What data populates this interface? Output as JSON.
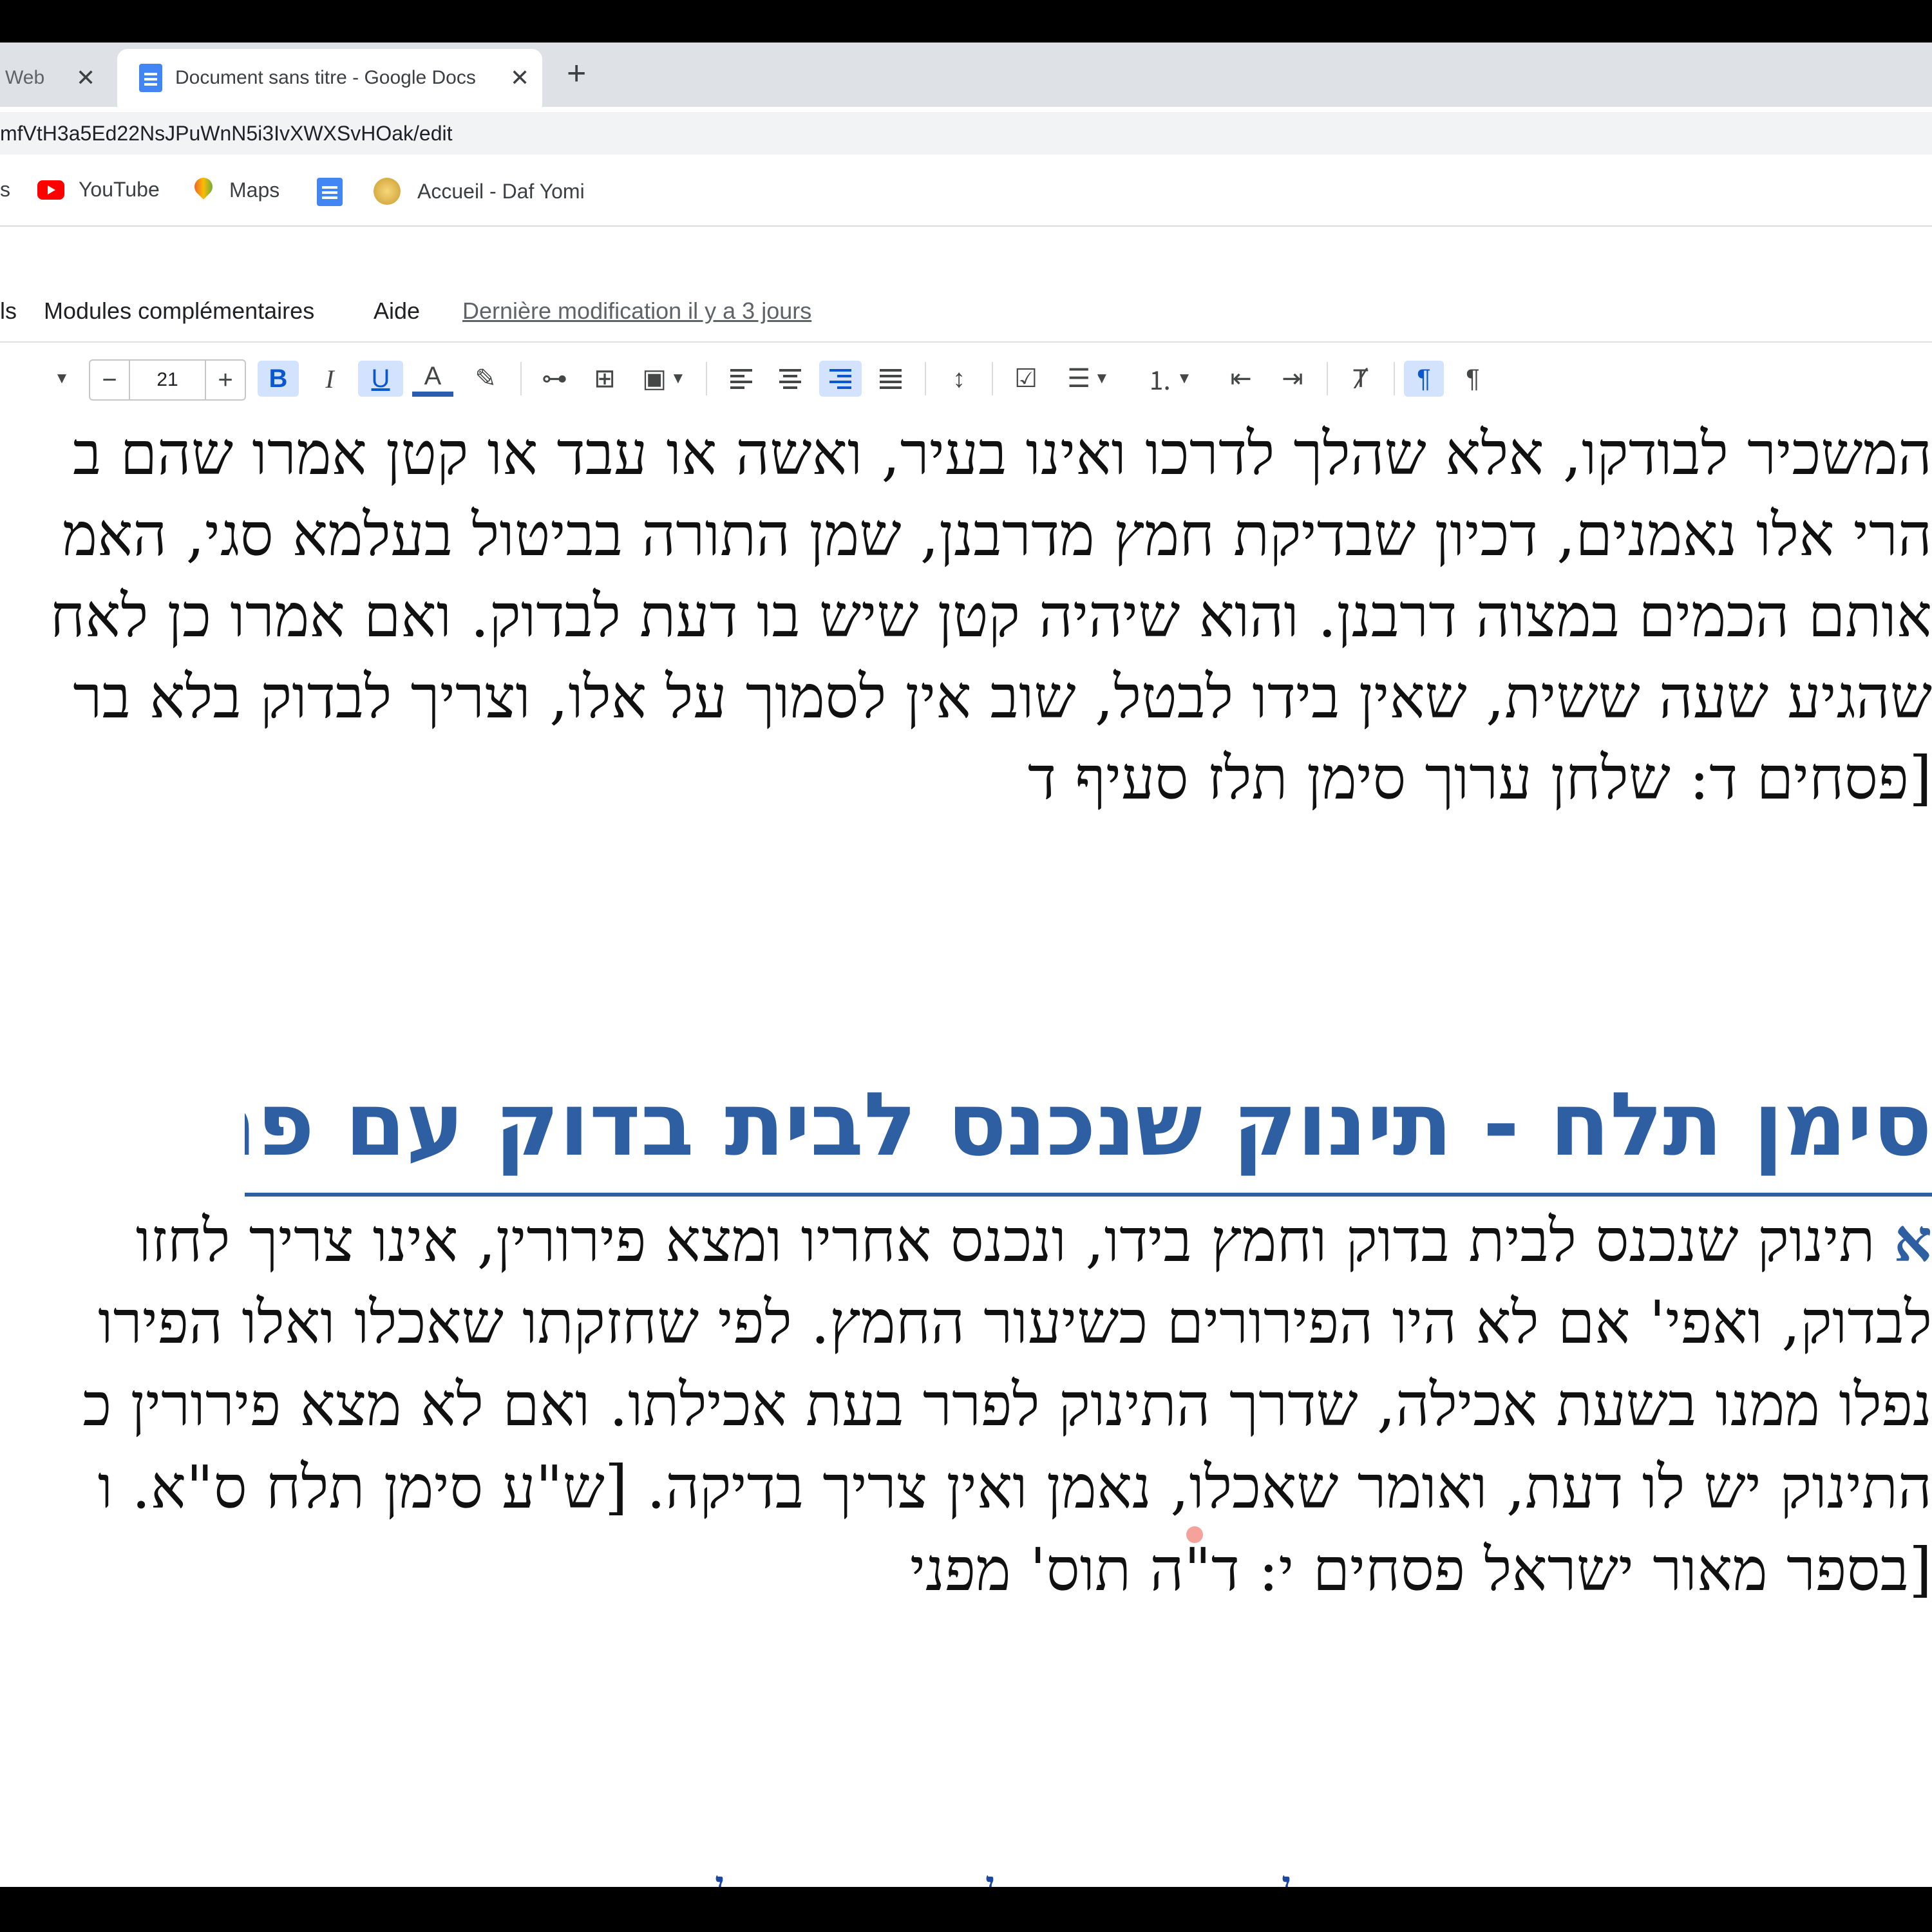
{
  "browser": {
    "tabs": [
      {
        "title": "Web",
        "active": false
      },
      {
        "title": "Document sans titre - Google Docs",
        "active": true
      }
    ],
    "new_tab": "+",
    "close": "✕",
    "url": "mfVtH3a5Ed22NsJPuWnN5i3IvXWXSvHOak/edit",
    "bookmarks": [
      {
        "label": "s",
        "icon": "folder-icon"
      },
      {
        "label": "YouTube",
        "icon": "youtube-icon"
      },
      {
        "label": "Maps",
        "icon": "maps-icon"
      },
      {
        "label": "",
        "icon": "docs-icon"
      },
      {
        "label": "Accueil - Daf Yomi",
        "icon": "daf-yomi-icon"
      }
    ]
  },
  "docs": {
    "menu": [
      "ls",
      "Modules complémentaires",
      "Aide"
    ],
    "last_edit": "Dernière modification il y a 3 jours",
    "toolbar": {
      "font_size": "21",
      "minus": "−",
      "plus": "+",
      "bold": "B",
      "italic": "I",
      "underline": "U",
      "text_color": "A",
      "text_color_hex": "#202124",
      "active_hex": "#d3e3fd"
    }
  },
  "document": {
    "para1_lines": [
      "המשכיר לבודקו, אלא שהלך לדרכו ואינו בעיר, ואשה או עבד או קטן אמרו שהם ב",
      "הרי אלו נאמנים, דכיון שבדיקת חמץ מדרבנן, שמן התורה בביטול בעלמא סגי, האמ",
      "אותם הכמים במצוה דרבנן. והוא שיהיה קטן שיש בו דעת לבדוק. ואם אמרו כן לאח",
      "שהגיע שעה ששית, שאין בידו לבטל, שוב אין לסמוך על אלו, וצריך לבדוק בלא בר",
      "[פסחים ד: שלחן ערוך סימן תלז סעיף ד"
    ],
    "heading": "סימן תלח - תינוק שנכנס לבית בדוק עם פתו בידו",
    "para2_first_letter": "א",
    "para2_lines": [
      "תינוק שנכנס לבית בדוק וחמץ בידו, ונכנס אחריו ומצא פירורין, אינו צריך לחזו",
      "לבדוק, ואפי' אם לא היו הפירורים כשיעור החמץ. לפי שחזקתו שאכלו ואלו הפירו",
      "נפלו ממנו בשעת אכילה, שדרך התינוק לפרר בעת אכילתו. ואם לא מצא פירורין כ",
      "התינוק יש לו דעת, ואומר שאכלו, נאמן ואין צריך בדיקה. [ש\"ע סימן תלח ס\"א. ו",
      "[בספר מאור ישראל פסחים י: ד\"ה תוס' מפני"
    ],
    "bottom_fragments": [
      "ן",
      "ן",
      "ן"
    ]
  }
}
